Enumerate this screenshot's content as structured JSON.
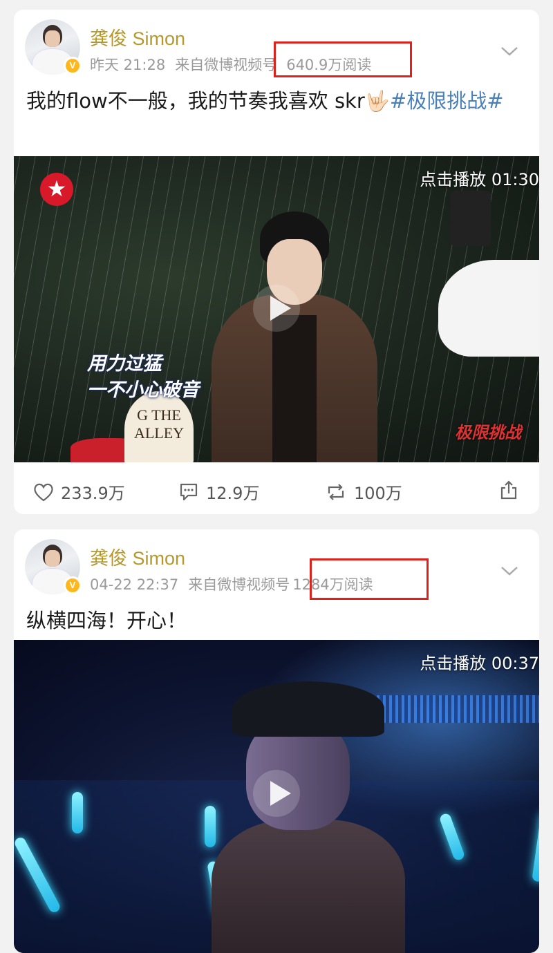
{
  "posts": [
    {
      "author": "龚俊 Simon",
      "time": "昨天 21:28",
      "source": "来自微博视频号",
      "reads": "640.9万阅读",
      "text_main": "我的flow不一般，我的节奏我喜欢 skr🤟🏻",
      "hashtag": "#极限挑战#",
      "video": {
        "label": "点击播放 01:30",
        "caption_line1": "用力过猛",
        "caption_line2": "一不小心破音",
        "sign_text": "G THE ALLEY",
        "show_logo": "极限挑战"
      },
      "actions": {
        "likes": "233.9万",
        "comments": "12.9万",
        "reposts": "100万"
      },
      "icons": [
        "heart-icon",
        "comment-icon",
        "repost-icon",
        "share-icon",
        "chevron-down-icon",
        "play-icon",
        "verified-badge-icon"
      ]
    },
    {
      "author": "龚俊 Simon",
      "time": "04-22 22:37",
      "source": "来自微博视频号",
      "reads": "1284万阅读",
      "text_main": "纵横四海！开心！",
      "video": {
        "label": "点击播放 00:37"
      }
    }
  ],
  "colors": {
    "author": "#b59a2a",
    "meta": "#9a9a9a",
    "hashtag": "#4a7fb8",
    "highlight_box": "#e0201b",
    "verified": "#ffb81c"
  }
}
